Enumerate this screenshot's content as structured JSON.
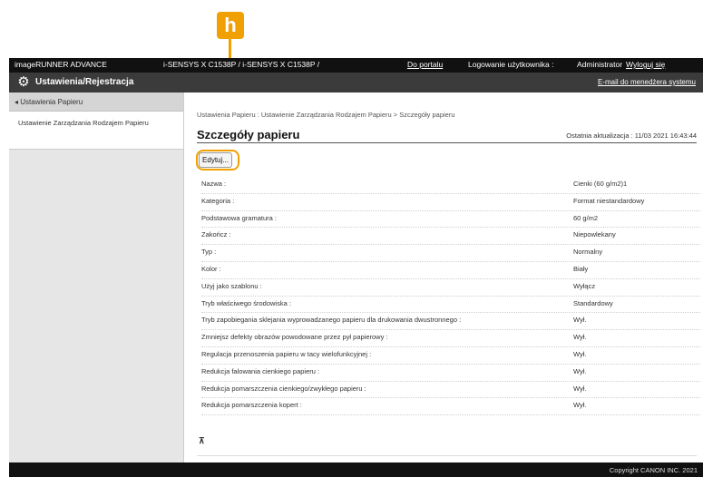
{
  "callout": {
    "letter": "h"
  },
  "topbar": {
    "product": "imageRUNNER ADVANCE",
    "model": "i-SENSYS X C1538P / i-SENSYS X C1538P /",
    "portal": "Do portalu",
    "login_label": "Logowanie użytkownika :",
    "user": "Administrator",
    "logout": "Wyloguj się"
  },
  "titlebar": {
    "title": "Ustawienia/Rejestracja",
    "email": "E-mail do menedżera systemu",
    "icon": "gear-icon"
  },
  "sidebar": {
    "back_label": "◂ Ustawienia Papieru",
    "items": [
      {
        "label": "Ustawienie Zarządzania Rodzajem Papieru"
      }
    ]
  },
  "main": {
    "breadcrumb": "Ustawienia Papieru : Ustawienie Zarządzania Rodzajem Papieru > Szczegóły papieru",
    "title": "Szczegóły papieru",
    "last_update": "Ostatnia aktualizacja : 11/03 2021 16:43:44",
    "edit_label": "Edytuj...",
    "to_top": "⊼"
  },
  "details": [
    {
      "label": "Nazwa :",
      "value": "Cienki (60 g/m2)1"
    },
    {
      "label": "Kategoria :",
      "value": "Format niestandardowy"
    },
    {
      "label": "Podstawowa gramatura :",
      "value": "60 g/m2"
    },
    {
      "label": "Zakończ :",
      "value": "Niepowlekany"
    },
    {
      "label": "Typ :",
      "value": "Normalny"
    },
    {
      "label": "Kolor :",
      "value": "Biały"
    },
    {
      "label": "Użyj jako szablonu :",
      "value": "Wyłącz"
    },
    {
      "label": "Tryb właściwego środowiska :",
      "value": "Standardowy"
    },
    {
      "label": "Tryb zapobiegania sklejania wyprowadzanego papieru dla drukowania dwustronnego :",
      "value": "Wył."
    },
    {
      "label": "Zmniejsz defekty obrazów powodowane przez pył papierowy :",
      "value": "Wył."
    },
    {
      "label": "Regulacja przenoszenia papieru w tacy wielofunkcyjnej :",
      "value": "Wył."
    },
    {
      "label": "Redukcja falowania cienkiego papieru :",
      "value": "Wył."
    },
    {
      "label": "Redukcja pomarszczenia cienkiego/zwykłego papieru :",
      "value": "Wył."
    },
    {
      "label": "Redukcja pomarszczenia kopert :",
      "value": "Wył."
    }
  ],
  "footer": {
    "copyright": "Copyright CANON INC. 2021"
  },
  "colors": {
    "accent": "#f0a000",
    "topbar": "#111111",
    "titlebar": "#3b3b3b",
    "sidebar": "#e6e6e6"
  }
}
